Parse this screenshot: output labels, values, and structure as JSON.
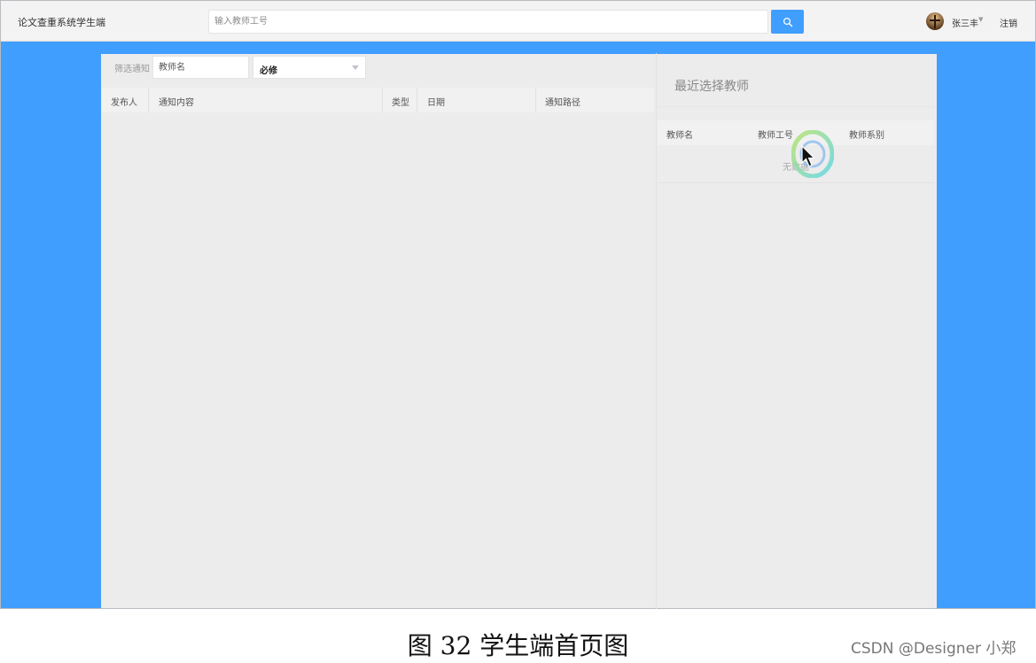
{
  "header": {
    "app_title": "论文查重系统学生端",
    "search_placeholder": "输入教师工号",
    "user_name": "张三丰",
    "logout_label": "注销"
  },
  "filter": {
    "label": "筛选通知",
    "teacher_placeholder": "教师名",
    "type_selected": "必修"
  },
  "notice_table": {
    "columns": [
      "发布人",
      "通知内容",
      "类型",
      "日期",
      "通知路径"
    ]
  },
  "recent": {
    "title": "最近选择教师",
    "columns": [
      "教师名",
      "教师工号",
      "教师系别"
    ],
    "empty_text": "无数据"
  },
  "caption": "图 32 学生端首页图",
  "watermark": "CSDN @Designer 小郑",
  "colors": {
    "primary": "#409eff",
    "header_bg": "#f3f3f3",
    "card_bg": "#ececec"
  },
  "icons": {
    "search": "search-icon",
    "avatar": "avatar",
    "dropdown": "chevron-down-icon",
    "cursor": "mouse-pointer-icon"
  }
}
